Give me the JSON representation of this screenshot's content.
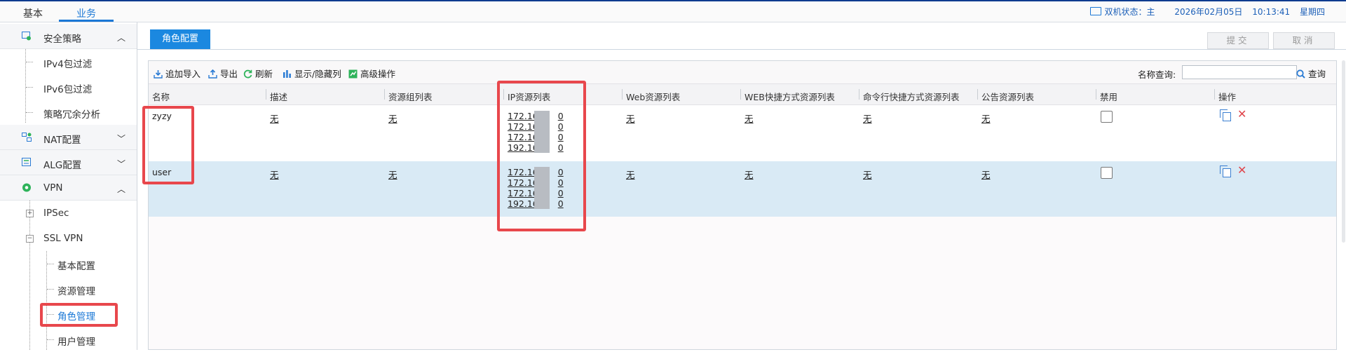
{
  "top": {
    "tabs": [
      {
        "label": "基本"
      },
      {
        "label": "业务"
      }
    ],
    "status": {
      "ha_label": "双机状态：主",
      "date": "2026年02月05日",
      "time": "10:13:41",
      "weekday": "星期四"
    }
  },
  "sidebar": {
    "items": [
      {
        "label": "安全策略",
        "icon": "shield-policy-icon"
      },
      {
        "label": "IPv4包过滤"
      },
      {
        "label": "IPv6包过滤"
      },
      {
        "label": "策略冗余分析"
      },
      {
        "label": "NAT配置",
        "icon": "nat-icon"
      },
      {
        "label": "ALG配置",
        "icon": "alg-icon"
      },
      {
        "label": "VPN",
        "icon": "vpn-icon"
      },
      {
        "label": "IPSec"
      },
      {
        "label": "SSL VPN"
      },
      {
        "label": "基本配置"
      },
      {
        "label": "资源管理"
      },
      {
        "label": "角色管理"
      },
      {
        "label": "用户管理"
      }
    ]
  },
  "page": {
    "tab_label": "角色配置",
    "submit_label": "提交",
    "cancel_label": "取消"
  },
  "toolbar": {
    "import_label": "追加导入",
    "export_label": "导出",
    "refresh_label": "刷新",
    "columns_label": "显示/隐藏列",
    "advanced_label": "高级操作",
    "search_label": "名称查询:",
    "search_value": "",
    "search_button": "查询"
  },
  "table": {
    "headers": [
      "名称",
      "描述",
      "资源组列表",
      "IP资源列表",
      "Web资源列表",
      "WEB快捷方式资源列表",
      "命令行快捷方式资源列表",
      "公告资源列表",
      "禁用",
      "操作"
    ],
    "rows": [
      {
        "name": "zyzy",
        "desc": "无",
        "groups": "无",
        "ips": [
          "172.16",
          "172.16",
          "172.16",
          "192.16"
        ],
        "ip_suffix": "0",
        "web": "无",
        "web_shortcut": "无",
        "cli_shortcut": "无",
        "notice": "无",
        "disabled": false
      },
      {
        "name": "user",
        "desc": "无",
        "groups": "无",
        "ips": [
          "172.16",
          "172.16",
          "172.16",
          "192.16"
        ],
        "ip_suffix": "0",
        "web": "无",
        "web_shortcut": "无",
        "cli_shortcut": "无",
        "notice": "无",
        "disabled": false
      }
    ]
  },
  "colors": {
    "accent": "#1b88e0",
    "highlight": "#e8474c",
    "row_selected": "#d9eaf5"
  }
}
